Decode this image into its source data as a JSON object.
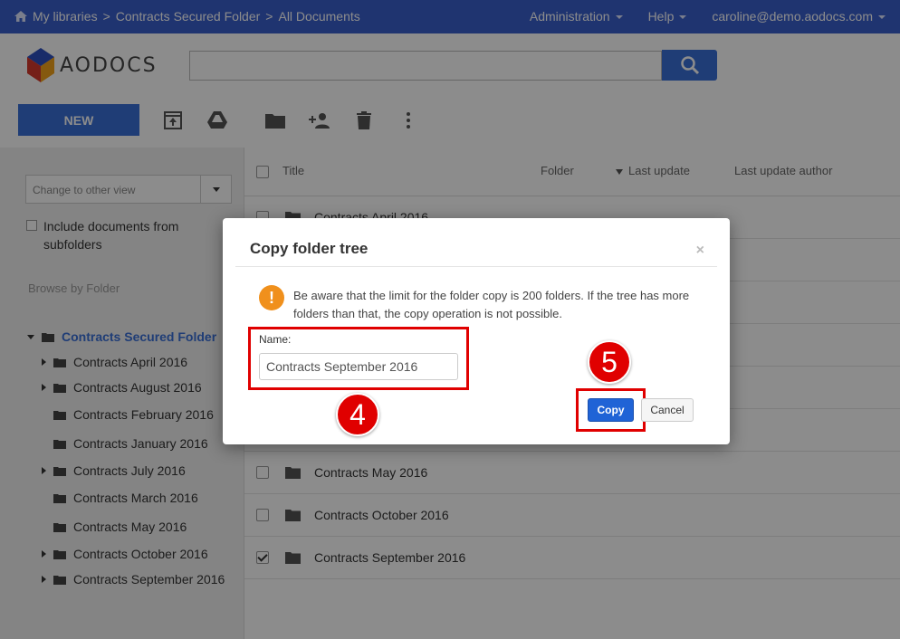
{
  "topbar": {
    "crumbs": [
      "My libraries",
      "Contracts Secured Folder",
      "All Documents"
    ],
    "admin": "Administration",
    "help": "Help",
    "user": "caroline@demo.aodocs.com"
  },
  "header": {
    "logo": "AODOCS",
    "search_placeholder": "",
    "new_label": "NEW"
  },
  "sidebar": {
    "view_select": "Change to other view",
    "include_label": "Include documents from subfolders",
    "browse_label": "Browse by Folder",
    "root": "Contracts Secured Folder",
    "folders": [
      {
        "label": "Contracts April 2016",
        "expandable": true
      },
      {
        "label": "Contracts August 2016",
        "expandable": true
      },
      {
        "label": "Contracts February 2016",
        "expandable": false
      },
      {
        "label": "Contracts January 2016",
        "expandable": false
      },
      {
        "label": "Contracts July 2016",
        "expandable": true
      },
      {
        "label": "Contracts March 2016",
        "expandable": false
      },
      {
        "label": "Contracts May 2016",
        "expandable": false
      },
      {
        "label": "Contracts October 2016",
        "expandable": true
      },
      {
        "label": "Contracts September 2016",
        "expandable": true
      }
    ]
  },
  "list": {
    "columns": {
      "title": "Title",
      "folder": "Folder",
      "last_update": "Last update",
      "author": "Last update author"
    },
    "rows": [
      {
        "name": "Contracts April 2016",
        "checked": false
      },
      {
        "name": "",
        "checked": false
      },
      {
        "name": "",
        "checked": false
      },
      {
        "name": "",
        "checked": false
      },
      {
        "name": "",
        "checked": false
      },
      {
        "name": "",
        "checked": false
      },
      {
        "name": "Contracts May 2016",
        "checked": false
      },
      {
        "name": "Contracts October 2016",
        "checked": false
      },
      {
        "name": "Contracts September 2016",
        "checked": true
      }
    ]
  },
  "modal": {
    "title": "Copy folder tree",
    "close": "×",
    "warning": "Be aware that the limit for the folder copy is 200 folders. If the tree has more folders than that, the copy operation is not possible.",
    "name_label": "Name:",
    "name_value": "Contracts September 2016",
    "copy_label": "Copy",
    "cancel_label": "Cancel"
  },
  "steps": {
    "name_step": "4",
    "copy_step": "5"
  },
  "colors": {
    "brand": "#3a5fcd",
    "primary_button": "#1f63d6",
    "highlight": "#e00000",
    "warning": "#f0901c"
  }
}
